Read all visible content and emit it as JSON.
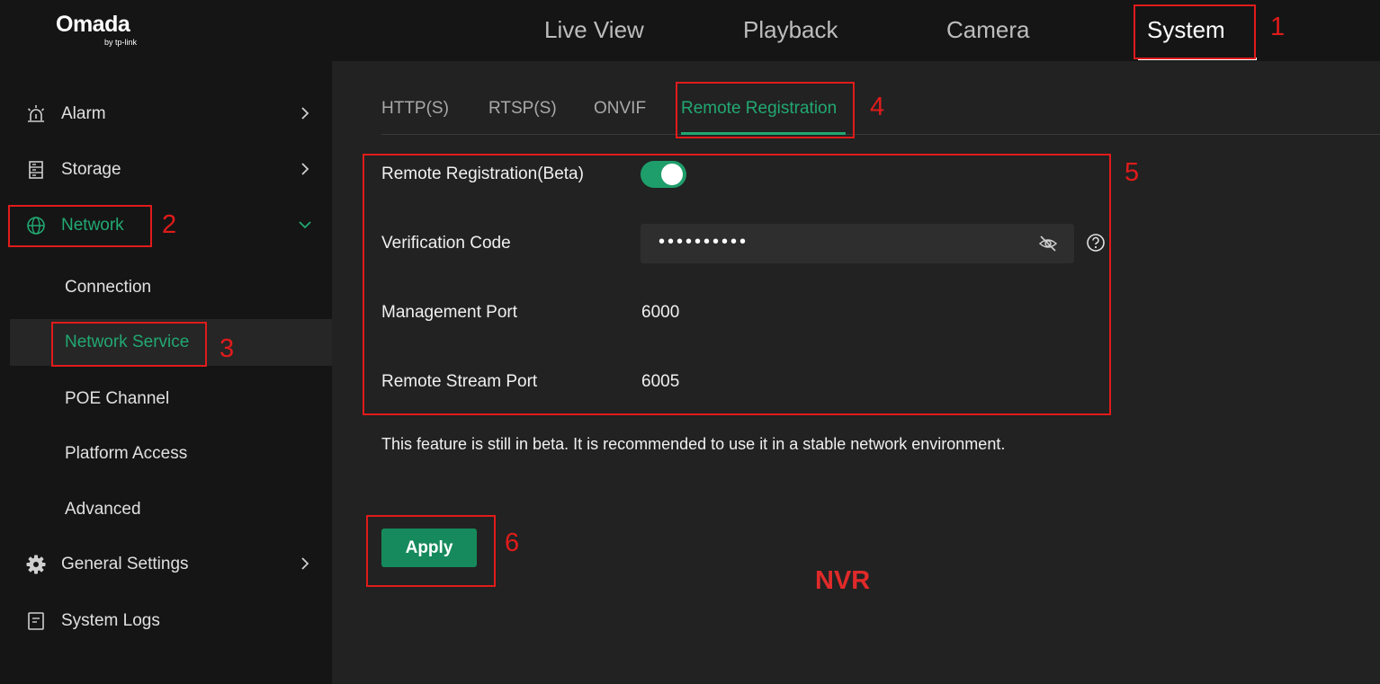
{
  "app": {
    "logo": "Omada",
    "logo_sub": "by tp-link"
  },
  "topnav": {
    "items": [
      "Live View",
      "Playback",
      "Camera",
      "System"
    ],
    "active": "System"
  },
  "sidebar": {
    "items": [
      {
        "label": "Alarm",
        "icon": "alarm-icon"
      },
      {
        "label": "Storage",
        "icon": "storage-icon"
      },
      {
        "label": "Network",
        "icon": "globe-icon",
        "expanded": true
      },
      {
        "label": "General Settings",
        "icon": "gear-icon"
      },
      {
        "label": "System Logs",
        "icon": "log-icon"
      }
    ],
    "network_sub": [
      "Connection",
      "Network Service",
      "POE Channel",
      "Platform Access",
      "Advanced"
    ],
    "active_sub": "Network Service"
  },
  "tabs": {
    "items": [
      "HTTP(S)",
      "RTSP(S)",
      "ONVIF",
      "Remote Registration"
    ],
    "active": "Remote Registration"
  },
  "form": {
    "remote_registration": {
      "label": "Remote Registration(Beta)",
      "enabled": true
    },
    "verification_code": {
      "label": "Verification Code",
      "masked_value": "••••••••••"
    },
    "management_port": {
      "label": "Management Port",
      "value": "6000"
    },
    "remote_stream_port": {
      "label": "Remote Stream Port",
      "value": "6005"
    }
  },
  "note": "This feature is still in beta. It is recommended to use it in a stable network environment.",
  "apply_label": "Apply",
  "annotations": {
    "numbers": [
      "1",
      "2",
      "3",
      "4",
      "5",
      "6"
    ],
    "device_label": "NVR"
  },
  "colors": {
    "accent_green": "#22a872",
    "annotation_red": "#e01b1b",
    "background": "#222222",
    "sidebar": "#151515"
  }
}
